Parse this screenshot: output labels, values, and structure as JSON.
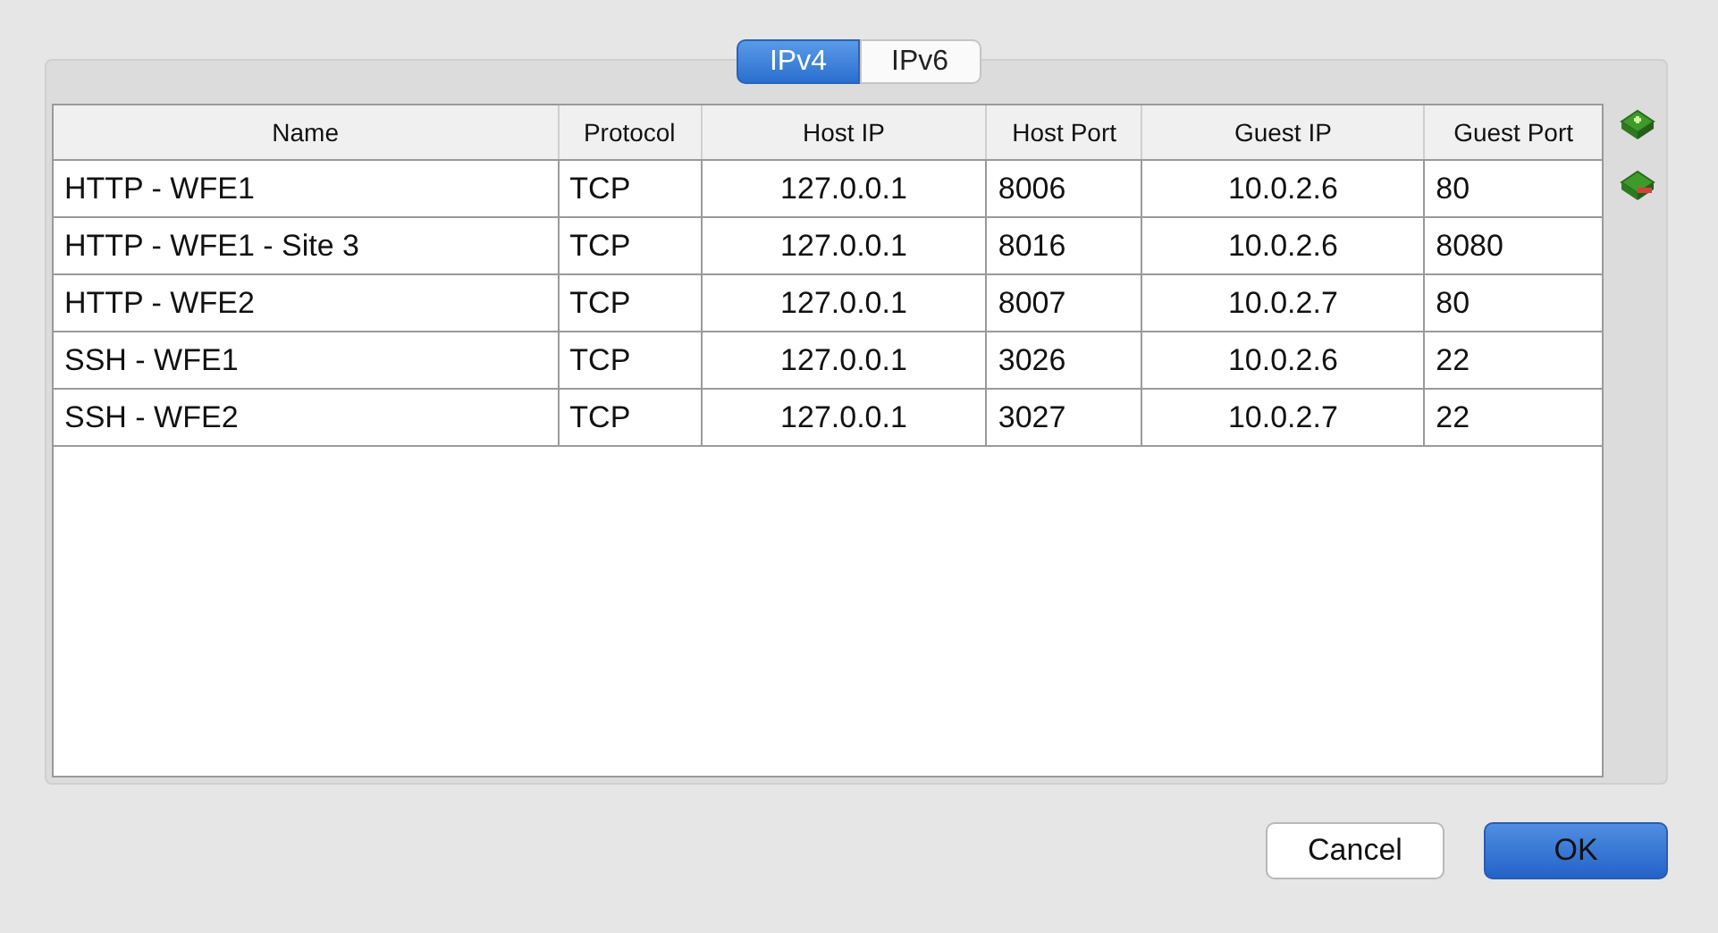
{
  "tabs": [
    {
      "label": "IPv4",
      "selected": true
    },
    {
      "label": "IPv6",
      "selected": false
    }
  ],
  "table": {
    "columns": [
      "Name",
      "Protocol",
      "Host IP",
      "Host Port",
      "Guest IP",
      "Guest Port"
    ],
    "rows": [
      [
        "HTTP - WFE1",
        "TCP",
        "127.0.0.1",
        "8006",
        "10.0.2.6",
        "80"
      ],
      [
        "HTTP - WFE1 - Site 3",
        "TCP",
        "127.0.0.1",
        "8016",
        "10.0.2.6",
        "8080"
      ],
      [
        "HTTP - WFE2",
        "TCP",
        "127.0.0.1",
        "8007",
        "10.0.2.7",
        "80"
      ],
      [
        "SSH - WFE1",
        "TCP",
        "127.0.0.1",
        "3026",
        "10.0.2.6",
        "22"
      ],
      [
        "SSH - WFE2",
        "TCP",
        "127.0.0.1",
        "3027",
        "10.0.2.7",
        "22"
      ]
    ]
  },
  "buttons": [
    {
      "label": "Cancel",
      "kind": "normal"
    },
    {
      "label": "OK",
      "kind": "default"
    }
  ]
}
